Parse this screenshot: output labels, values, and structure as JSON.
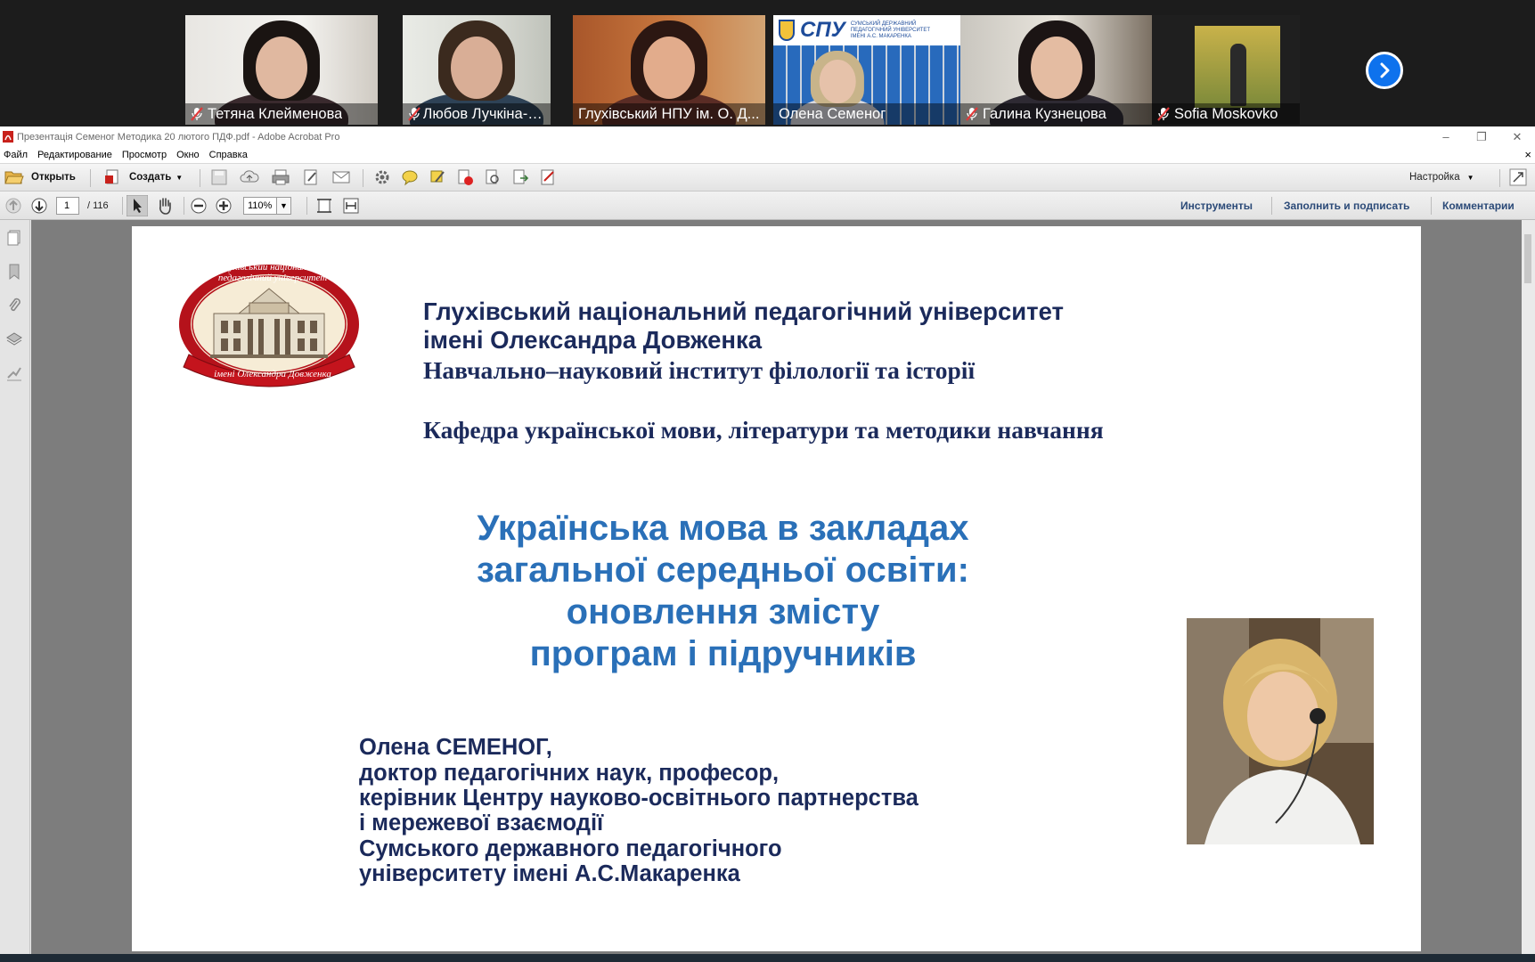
{
  "video_strip": {
    "participants": [
      {
        "name": "Тетяна Клейменова",
        "muted": true,
        "active": false
      },
      {
        "name": "Любов Лучкіна-Загор...",
        "muted": true,
        "active": false
      },
      {
        "name": "Глухівський НПУ ім. О. Д...",
        "muted": false,
        "active": true
      },
      {
        "name": "Олена Семеног",
        "muted": false,
        "active": false,
        "background_sign": "СПУ",
        "background_sign_sub": "СУМСЬКИЙ ДЕРЖАВНИЙ ПЕДАГОГІЧНИЙ УНІВЕРСИТЕТ ІМЕНІ А.С. МАКАРЕНКА"
      },
      {
        "name": "Галина Кузнецова",
        "muted": true,
        "active": false
      },
      {
        "name": "Sofia Moskovko",
        "muted": true,
        "active": false
      }
    ],
    "next_icon": "chevron-right-icon"
  },
  "window": {
    "title": "Презентація Семеног  Методика  20 лютого ПДФ.pdf - Adobe Acrobat Pro",
    "controls": [
      "–",
      "❐",
      "✕"
    ]
  },
  "menu": [
    "Файл",
    "Редактирование",
    "Просмотр",
    "Окно",
    "Справка"
  ],
  "toolbar": {
    "open_label": "Открыть",
    "create_label": "Создать",
    "customize_label": "Настройка"
  },
  "nav": {
    "current_page": "1",
    "total_pages": "/ 116",
    "zoom": "110%",
    "tools_label": "Инструменты",
    "fill_sign_label": "Заполнить и подписать",
    "comments_label": "Комментарии"
  },
  "slide": {
    "university_line1": "Глухівський національний педагогічний університет",
    "university_line2": "імені Олександра Довженка",
    "institute": "Навчально–науковий інститут філології та історії",
    "department": "Кафедра української мови, літератури та методики навчання",
    "talk_title": [
      "Українська мова в закладах",
      "загальної середньої освіти:",
      "оновлення змісту",
      "програм і підручників"
    ],
    "author_lines": [
      "Олена СЕМЕНОГ,",
      "доктор педагогічних наук, професор,",
      "керівник  Центру науково-освітнього партнерства",
      "і мережевої взаємодії",
      "Сумського державного педагогічного",
      "університету імені А.С.Макаренка"
    ],
    "seal_text_top": "Глухівський національний педагогічний університет",
    "seal_text_bottom": "імені Олександра Довженка"
  },
  "colors": {
    "active_tile_border": "#23d160",
    "next_button": "#0e72ed",
    "slide_title_blue": "#2a70b8",
    "slide_navy": "#1b2a5b",
    "muted_mic": "#e03a3a"
  }
}
